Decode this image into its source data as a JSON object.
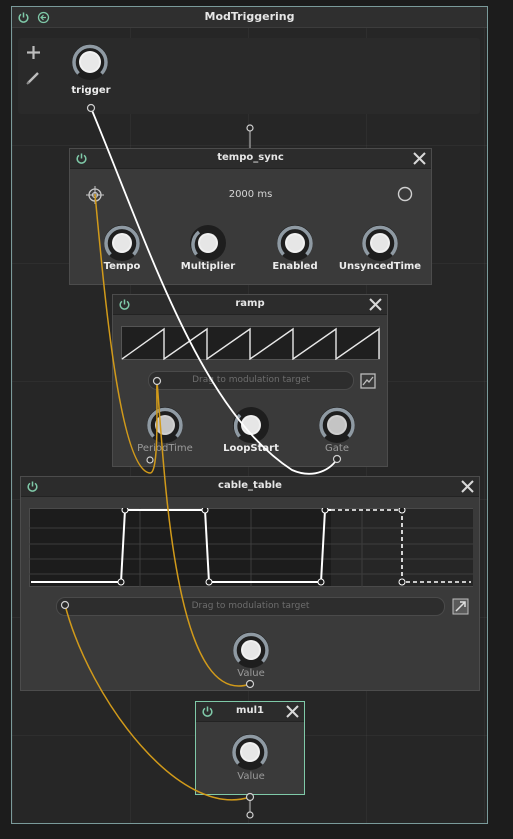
{
  "window": {
    "title": "ModTriggering"
  },
  "colors": {
    "accent": "#7fc9a8",
    "wire_audio": "#d19a1a",
    "wire_pulse": "#ffffff",
    "knob_ring": "#8f9aa3"
  },
  "toolbar": {
    "add_icon": "plus-icon",
    "edit_icon": "pencil-icon"
  },
  "trigger_module": {
    "knob_label": "trigger"
  },
  "tempo_sync": {
    "title": "tempo_sync",
    "time_text": "2000 ms",
    "knobs": [
      "Tempo",
      "Multiplier",
      "Enabled",
      "UnsyncedTime"
    ]
  },
  "ramp": {
    "title": "ramp",
    "drag_text": "Drag to modulation target",
    "knobs": [
      "PeriodTime",
      "LoopStart",
      "Gate"
    ]
  },
  "cable_table": {
    "title": "cable_table",
    "drag_text": "Drag to modulation target",
    "knob": "Value"
  },
  "mul1": {
    "title": "mul1",
    "knob": "Value"
  }
}
